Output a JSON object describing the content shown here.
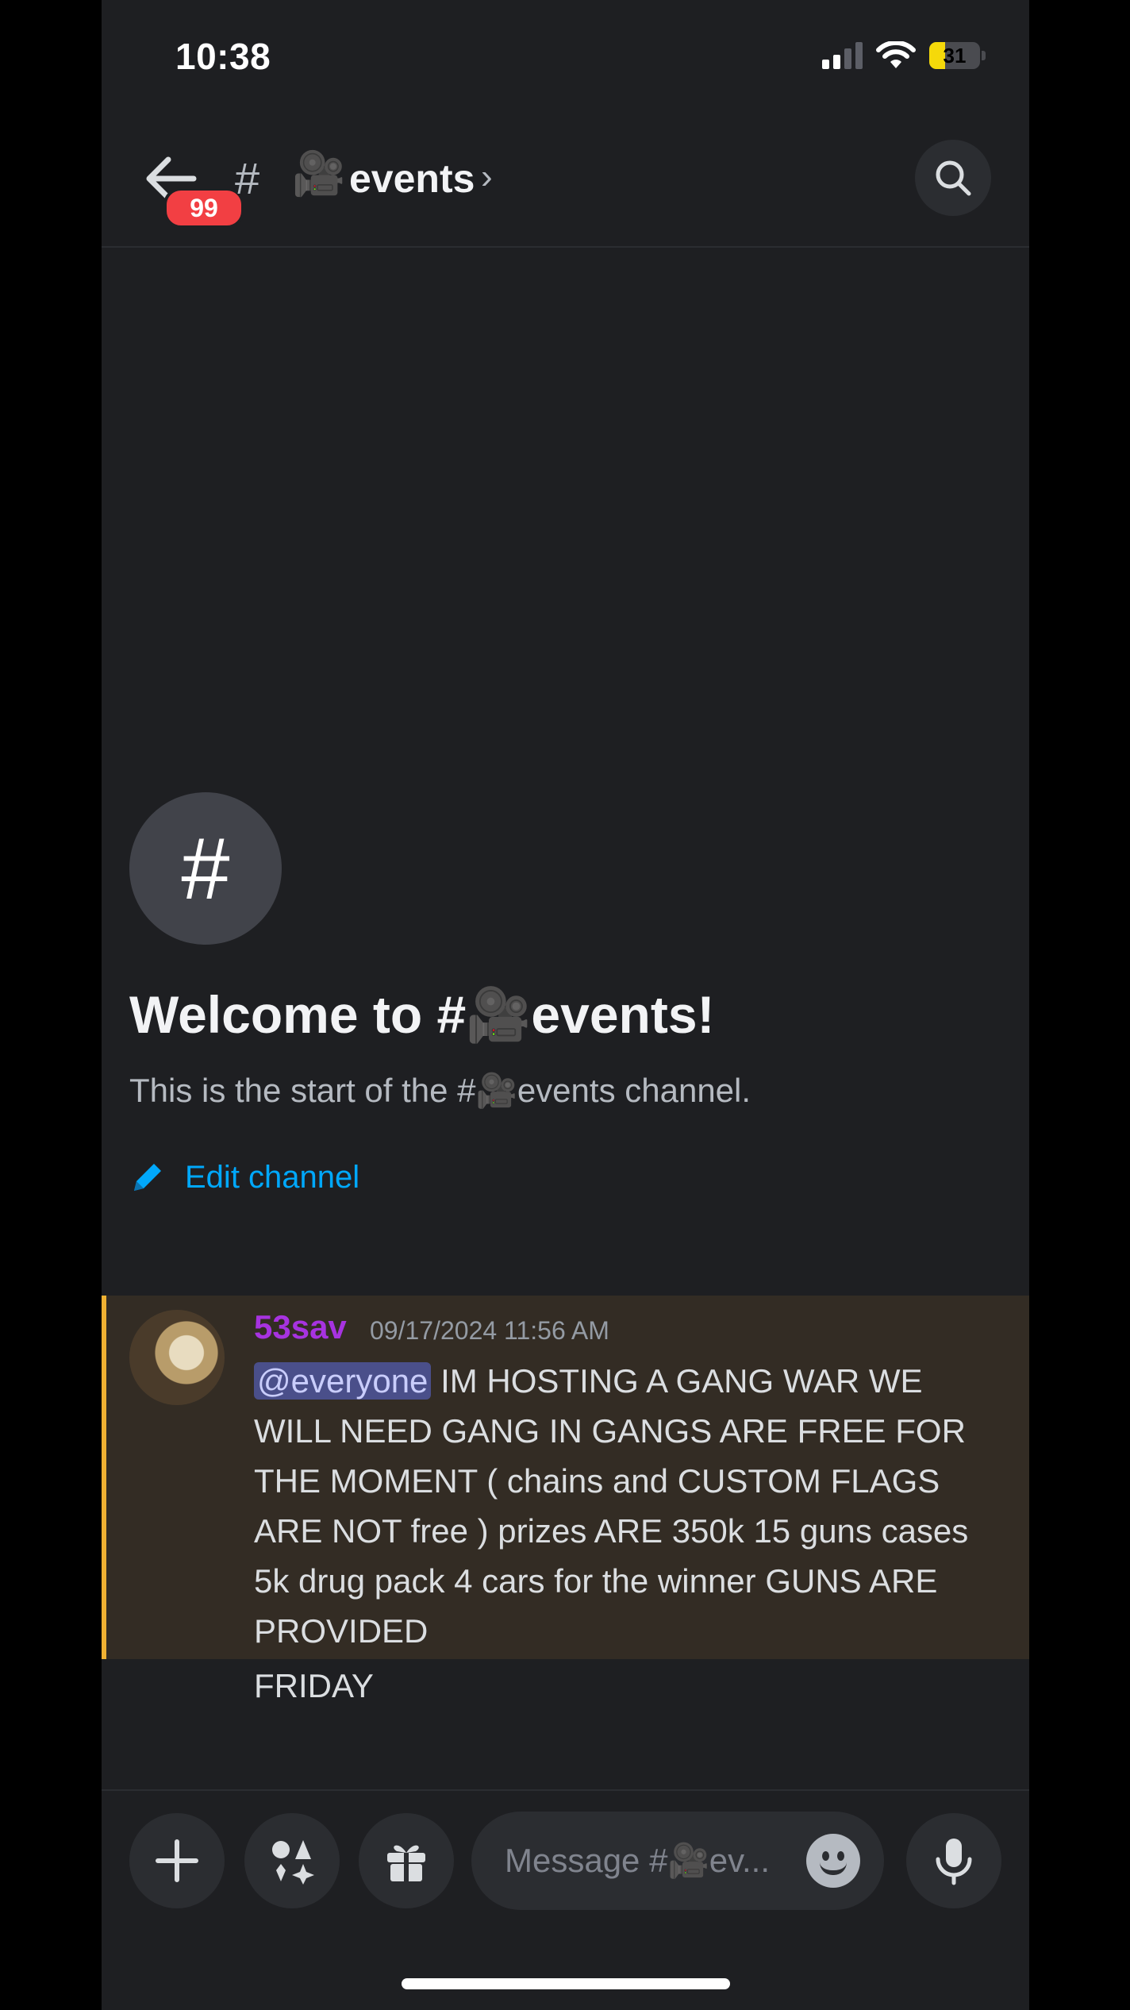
{
  "status_bar": {
    "time": "10:38",
    "battery": "31"
  },
  "header": {
    "unread_badge": "99",
    "channel_hash": "#",
    "channel_emoji": "🎥",
    "channel_name": "events",
    "chevron": "›",
    "icons": {
      "back": "arrow-left-icon",
      "search": "search-icon"
    }
  },
  "welcome": {
    "hash_symbol": "#",
    "title": "Welcome to #🎥events!",
    "subtitle": "This is the start of the #🎥events channel.",
    "edit_label": "Edit channel",
    "edit_icon": "pencil-icon"
  },
  "message": {
    "author": "53sav",
    "author_color": "#a733e0",
    "timestamp": "09/17/2024 11:56 AM",
    "mention": "@everyone",
    "text": " IM HOSTING A GANG WAR WE WILL NEED GANG IN GANGS ARE FREE FOR THE MOMENT ( chains and CUSTOM FLAGS ARE NOT  free ) prizes ARE 350k 15 guns cases 5k drug pack 4 cars for the winner GUNS ARE PROVIDED",
    "followup": "FRIDAY"
  },
  "composer": {
    "placeholder": "Message #🎥ev...",
    "icons": [
      "plus-icon",
      "apps-icon",
      "gift-icon",
      "emoji-icon",
      "microphone-icon"
    ]
  },
  "colors": {
    "background": "#1e1f22",
    "accent": "#00a8fc",
    "badge": "#f23f43",
    "highlight": "#332c24",
    "highlight_bar": "#f0b132"
  }
}
